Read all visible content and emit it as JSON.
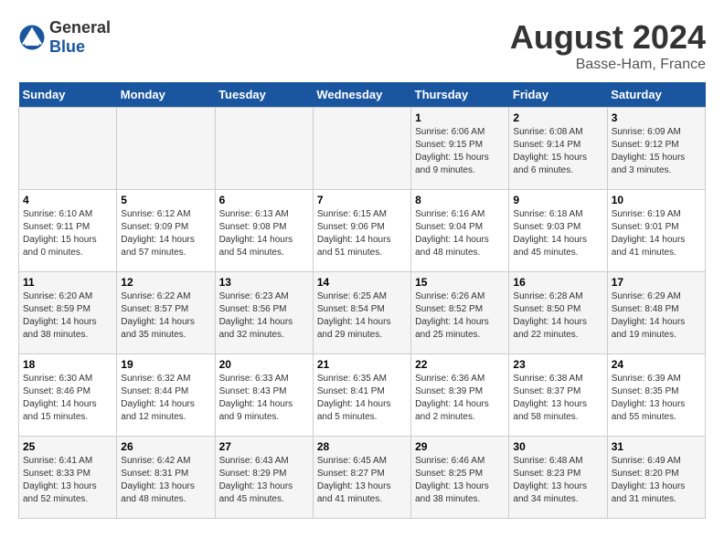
{
  "header": {
    "logo_general": "General",
    "logo_blue": "Blue",
    "main_title": "August 2024",
    "subtitle": "Basse-Ham, France"
  },
  "days_of_week": [
    "Sunday",
    "Monday",
    "Tuesday",
    "Wednesday",
    "Thursday",
    "Friday",
    "Saturday"
  ],
  "weeks": [
    [
      {
        "day": "",
        "sunrise": "",
        "sunset": "",
        "daylight": ""
      },
      {
        "day": "",
        "sunrise": "",
        "sunset": "",
        "daylight": ""
      },
      {
        "day": "",
        "sunrise": "",
        "sunset": "",
        "daylight": ""
      },
      {
        "day": "",
        "sunrise": "",
        "sunset": "",
        "daylight": ""
      },
      {
        "day": "1",
        "sunrise": "Sunrise: 6:06 AM",
        "sunset": "Sunset: 9:15 PM",
        "daylight": "Daylight: 15 hours and 9 minutes."
      },
      {
        "day": "2",
        "sunrise": "Sunrise: 6:08 AM",
        "sunset": "Sunset: 9:14 PM",
        "daylight": "Daylight: 15 hours and 6 minutes."
      },
      {
        "day": "3",
        "sunrise": "Sunrise: 6:09 AM",
        "sunset": "Sunset: 9:12 PM",
        "daylight": "Daylight: 15 hours and 3 minutes."
      }
    ],
    [
      {
        "day": "4",
        "sunrise": "Sunrise: 6:10 AM",
        "sunset": "Sunset: 9:11 PM",
        "daylight": "Daylight: 15 hours and 0 minutes."
      },
      {
        "day": "5",
        "sunrise": "Sunrise: 6:12 AM",
        "sunset": "Sunset: 9:09 PM",
        "daylight": "Daylight: 14 hours and 57 minutes."
      },
      {
        "day": "6",
        "sunrise": "Sunrise: 6:13 AM",
        "sunset": "Sunset: 9:08 PM",
        "daylight": "Daylight: 14 hours and 54 minutes."
      },
      {
        "day": "7",
        "sunrise": "Sunrise: 6:15 AM",
        "sunset": "Sunset: 9:06 PM",
        "daylight": "Daylight: 14 hours and 51 minutes."
      },
      {
        "day": "8",
        "sunrise": "Sunrise: 6:16 AM",
        "sunset": "Sunset: 9:04 PM",
        "daylight": "Daylight: 14 hours and 48 minutes."
      },
      {
        "day": "9",
        "sunrise": "Sunrise: 6:18 AM",
        "sunset": "Sunset: 9:03 PM",
        "daylight": "Daylight: 14 hours and 45 minutes."
      },
      {
        "day": "10",
        "sunrise": "Sunrise: 6:19 AM",
        "sunset": "Sunset: 9:01 PM",
        "daylight": "Daylight: 14 hours and 41 minutes."
      }
    ],
    [
      {
        "day": "11",
        "sunrise": "Sunrise: 6:20 AM",
        "sunset": "Sunset: 8:59 PM",
        "daylight": "Daylight: 14 hours and 38 minutes."
      },
      {
        "day": "12",
        "sunrise": "Sunrise: 6:22 AM",
        "sunset": "Sunset: 8:57 PM",
        "daylight": "Daylight: 14 hours and 35 minutes."
      },
      {
        "day": "13",
        "sunrise": "Sunrise: 6:23 AM",
        "sunset": "Sunset: 8:56 PM",
        "daylight": "Daylight: 14 hours and 32 minutes."
      },
      {
        "day": "14",
        "sunrise": "Sunrise: 6:25 AM",
        "sunset": "Sunset: 8:54 PM",
        "daylight": "Daylight: 14 hours and 29 minutes."
      },
      {
        "day": "15",
        "sunrise": "Sunrise: 6:26 AM",
        "sunset": "Sunset: 8:52 PM",
        "daylight": "Daylight: 14 hours and 25 minutes."
      },
      {
        "day": "16",
        "sunrise": "Sunrise: 6:28 AM",
        "sunset": "Sunset: 8:50 PM",
        "daylight": "Daylight: 14 hours and 22 minutes."
      },
      {
        "day": "17",
        "sunrise": "Sunrise: 6:29 AM",
        "sunset": "Sunset: 8:48 PM",
        "daylight": "Daylight: 14 hours and 19 minutes."
      }
    ],
    [
      {
        "day": "18",
        "sunrise": "Sunrise: 6:30 AM",
        "sunset": "Sunset: 8:46 PM",
        "daylight": "Daylight: 14 hours and 15 minutes."
      },
      {
        "day": "19",
        "sunrise": "Sunrise: 6:32 AM",
        "sunset": "Sunset: 8:44 PM",
        "daylight": "Daylight: 14 hours and 12 minutes."
      },
      {
        "day": "20",
        "sunrise": "Sunrise: 6:33 AM",
        "sunset": "Sunset: 8:43 PM",
        "daylight": "Daylight: 14 hours and 9 minutes."
      },
      {
        "day": "21",
        "sunrise": "Sunrise: 6:35 AM",
        "sunset": "Sunset: 8:41 PM",
        "daylight": "Daylight: 14 hours and 5 minutes."
      },
      {
        "day": "22",
        "sunrise": "Sunrise: 6:36 AM",
        "sunset": "Sunset: 8:39 PM",
        "daylight": "Daylight: 14 hours and 2 minutes."
      },
      {
        "day": "23",
        "sunrise": "Sunrise: 6:38 AM",
        "sunset": "Sunset: 8:37 PM",
        "daylight": "Daylight: 13 hours and 58 minutes."
      },
      {
        "day": "24",
        "sunrise": "Sunrise: 6:39 AM",
        "sunset": "Sunset: 8:35 PM",
        "daylight": "Daylight: 13 hours and 55 minutes."
      }
    ],
    [
      {
        "day": "25",
        "sunrise": "Sunrise: 6:41 AM",
        "sunset": "Sunset: 8:33 PM",
        "daylight": "Daylight: 13 hours and 52 minutes."
      },
      {
        "day": "26",
        "sunrise": "Sunrise: 6:42 AM",
        "sunset": "Sunset: 8:31 PM",
        "daylight": "Daylight: 13 hours and 48 minutes."
      },
      {
        "day": "27",
        "sunrise": "Sunrise: 6:43 AM",
        "sunset": "Sunset: 8:29 PM",
        "daylight": "Daylight: 13 hours and 45 minutes."
      },
      {
        "day": "28",
        "sunrise": "Sunrise: 6:45 AM",
        "sunset": "Sunset: 8:27 PM",
        "daylight": "Daylight: 13 hours and 41 minutes."
      },
      {
        "day": "29",
        "sunrise": "Sunrise: 6:46 AM",
        "sunset": "Sunset: 8:25 PM",
        "daylight": "Daylight: 13 hours and 38 minutes."
      },
      {
        "day": "30",
        "sunrise": "Sunrise: 6:48 AM",
        "sunset": "Sunset: 8:23 PM",
        "daylight": "Daylight: 13 hours and 34 minutes."
      },
      {
        "day": "31",
        "sunrise": "Sunrise: 6:49 AM",
        "sunset": "Sunset: 8:20 PM",
        "daylight": "Daylight: 13 hours and 31 minutes."
      }
    ]
  ]
}
